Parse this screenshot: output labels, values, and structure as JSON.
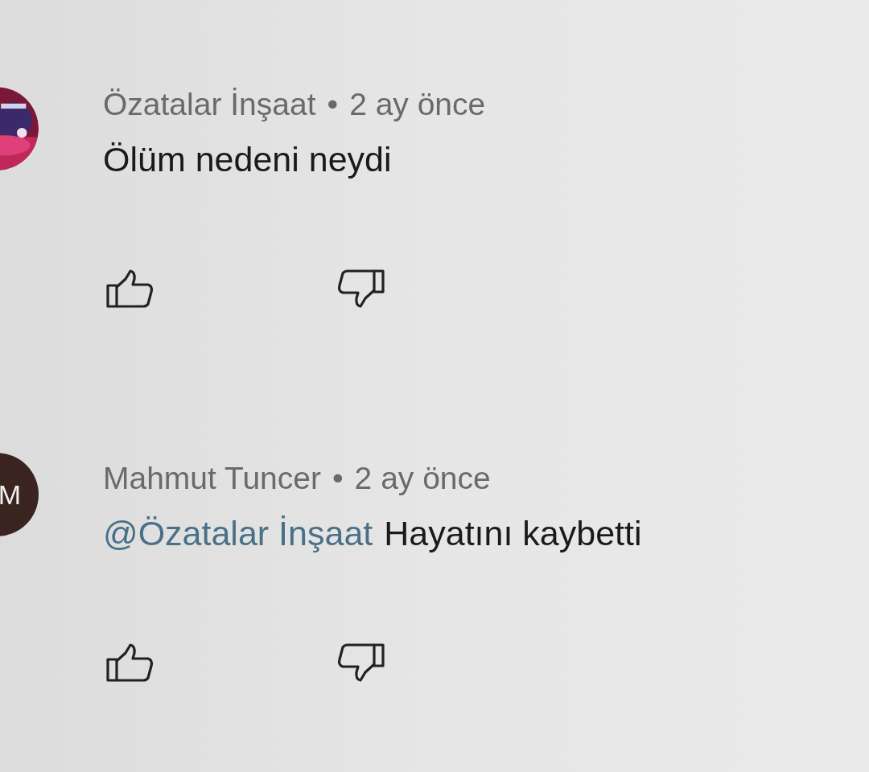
{
  "comments": [
    {
      "author": "Özatalar İnşaat",
      "separator": "•",
      "time": "2 ay önce",
      "text": "Ölüm nedeni neydi"
    },
    {
      "author": "Mahmut Tuncer",
      "separator": "•",
      "time": "2 ay önce",
      "avatar": {
        "kind": "letter",
        "letter": "M",
        "color": "#3a2420"
      },
      "mention": "@Özatalar İnşaat",
      "text": "Hayatını kaybetti"
    }
  ]
}
